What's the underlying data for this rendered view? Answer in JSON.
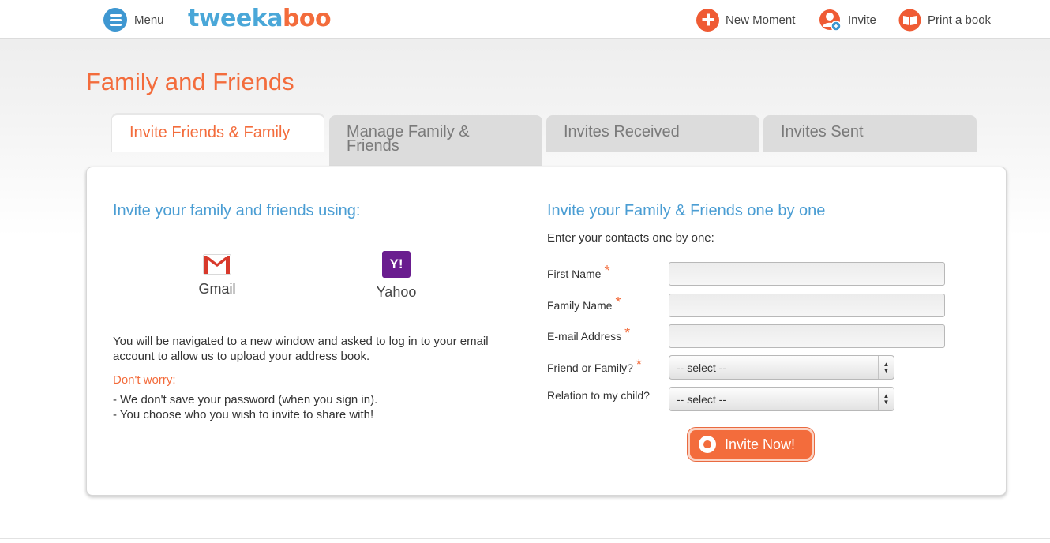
{
  "header": {
    "menu_label": "Menu",
    "logo_part1": "tweeka",
    "logo_part2": "boo",
    "nav": {
      "new_moment": "New Moment",
      "invite": "Invite",
      "print_book": "Print a book"
    }
  },
  "page": {
    "title": "Family and Friends"
  },
  "tabs": [
    {
      "label": "Invite Friends & Family",
      "active": true
    },
    {
      "label": "Manage Family & Friends",
      "active": false
    },
    {
      "label": "Invites Received",
      "active": false
    },
    {
      "label": "Invites Sent",
      "active": false
    }
  ],
  "left": {
    "heading": "Invite your family and friends using:",
    "providers": [
      {
        "label": "Gmail",
        "icon": "gmail-icon"
      },
      {
        "label": "Yahoo",
        "icon": "yahoo-icon",
        "glyph": "Y!"
      }
    ],
    "info": "You will be navigated to a new window and asked to log in to your email account to allow us to upload your address book.",
    "worry": "Don't worry:",
    "bullets": [
      "- We don't save your password (when you sign in).",
      "- You choose who you wish to invite to share with!"
    ]
  },
  "right": {
    "heading": "Invite your Family & Friends one by one",
    "intro": "Enter your contacts one by one:",
    "fields": {
      "first_name": {
        "label": "First Name",
        "value": ""
      },
      "family_name": {
        "label": "Family Name",
        "value": ""
      },
      "email": {
        "label": "E-mail Address",
        "value": ""
      },
      "friend_or_family": {
        "label": "Friend or Family?",
        "selected": "-- select --"
      },
      "relation": {
        "label": "Relation to my child?",
        "selected": "-- select --"
      }
    },
    "required_marker": "*",
    "submit_label": "Invite Now!"
  },
  "colors": {
    "accent_orange": "#f36c3c",
    "accent_blue": "#4a9dd3",
    "tab_inactive": "#dcdcdc",
    "yahoo_purple": "#6a1d8f"
  }
}
